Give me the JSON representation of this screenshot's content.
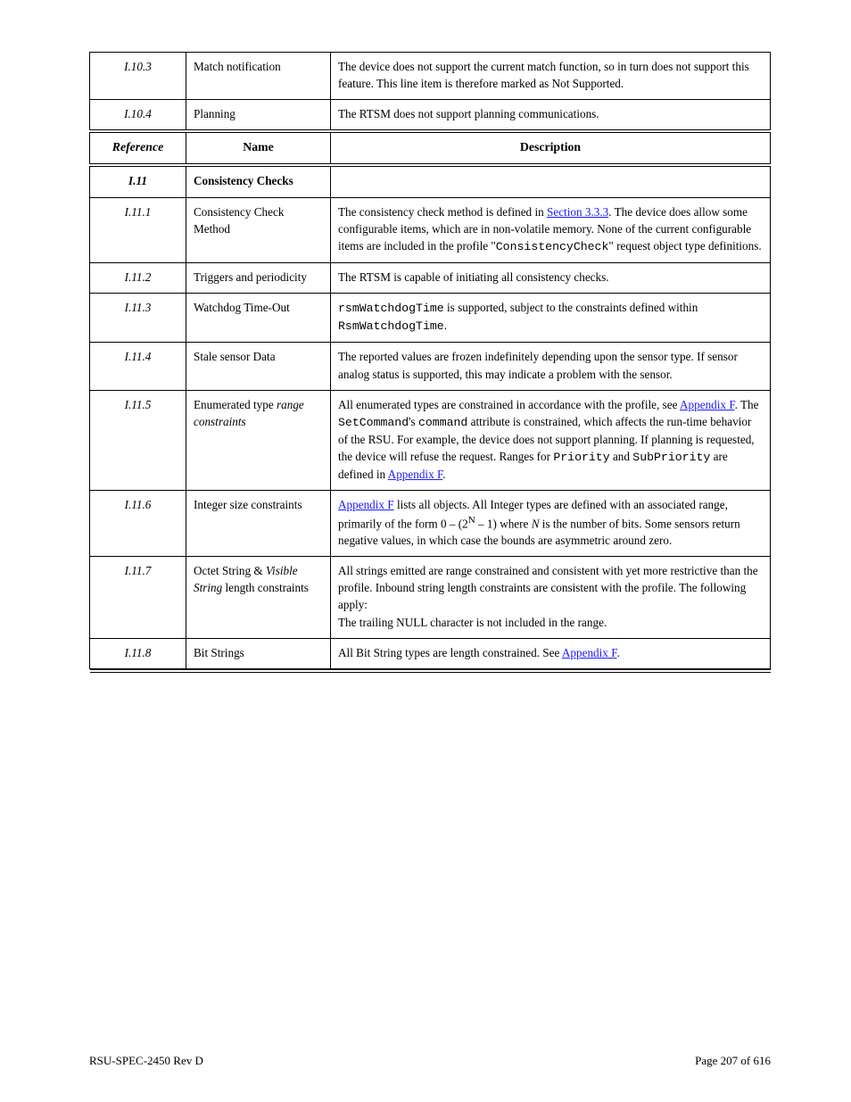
{
  "table_header": {
    "ref": "Reference",
    "name": "Name",
    "desc": "Description"
  },
  "rows": [
    {
      "ref": "I.10.3",
      "name": "Match notification",
      "desc_html": "The device does not support the current match function, so in turn does not support this feature. This line item is therefore marked as Not Supported."
    },
    {
      "ref": "I.10.4",
      "name": "Planning",
      "desc_html": "The RTSM does not support planning communications."
    }
  ],
  "section_header": {
    "ref": "I.11",
    "name": "Consistency Checks",
    "desc": ""
  },
  "section_rows": [
    {
      "ref": "I.11.1",
      "name": "Consistency Check Method",
      "desc_html": "The consistency check method is defined in <a class='sec' href='#' data-name='link-section-3-3-3' data-interactable='true'>Section 3.3.3</a>. The device does allow some configurable items, which are in non-volatile memory. None of the current configurable items are included in the profile \"<span class='tt'>ConsistencyCheck</span>\" request object type definitions."
    },
    {
      "ref": "I.11.2",
      "name": "Triggers and periodicity",
      "desc_html": "The RTSM is capable of initiating all consistency checks."
    },
    {
      "ref": "I.11.3",
      "name": "Watchdog Time-Out",
      "desc_html": "<span class='tt'>rsmWatchdogTime</span> is supported, subject to the constraints defined within <span class='tt'>RsmWatchdogTime</span>."
    },
    {
      "ref": "I.11.4",
      "name": "Stale sensor Data",
      "desc_html": "The reported values are frozen indefinitely depending upon the sensor type. If sensor analog status is supported, this may indicate a problem with the sensor."
    },
    {
      "ref": "I.11.5",
      "name": "Enumerated type <span class='italic'>range constraints</span>",
      "desc_html": "All enumerated types are constrained in accordance with the profile, see <a class='app' href='#' data-name='link-appendix-f-1' data-interactable='true'>Appendix F</a>. The <span class='tt'>SetCommand</span>'s <span class='tt'>command</span> attribute is constrained, which affects the run-time behavior of the RSU. For example, the device does not support planning. If planning is requested, the device will refuse the request. Ranges for <span class='tt'>Priority</span> and <span class='tt'>SubPriority</span> are defined in <a class='app' href='#' data-name='link-appendix-f-2' data-interactable='true'>Appendix F</a>."
    },
    {
      "ref": "I.11.6",
      "name": "Integer size constraints",
      "desc_html": "<a class='app' href='#' data-name='link-appendix-f-3' data-interactable='true'>Appendix F</a> lists all objects. All Integer types are defined with an associated range, primarily of the form 0 &ndash; (2<sup>N</sup> &ndash; 1) where <span class='italic'>N</span> is the number of bits. Some sensors return negative values, in which case the bounds are asymmetric around zero."
    },
    {
      "ref": "I.11.7",
      "name": "Octet String &amp; <span class='italic'>Visible String</span> length constraints",
      "desc_html": "All strings emitted are range constrained and consistent with yet more restrictive than the profile. Inbound string length constraints are consistent with the profile. The following apply:<br>The trailing NULL character is not included in the range."
    },
    {
      "ref": "I.11.8",
      "name": "Bit Strings",
      "desc_html": "All Bit String types are length constrained. See <a class='app' href='#' data-name='link-appendix-f-4' data-interactable='true'>Appendix F</a>."
    }
  ],
  "footer": {
    "left": "RSU-SPEC-2450 Rev D",
    "right": "Page 207 of 616"
  }
}
